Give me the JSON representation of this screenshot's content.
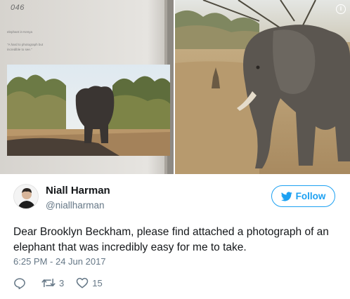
{
  "book": {
    "page_number": "046",
    "caption_title": "elephant in Kenya",
    "caption_line1": "\"A hard to photograph but",
    "caption_line2": "incredible to see.\""
  },
  "tweet": {
    "display_name": "Niall Harman",
    "handle": "@niallharman",
    "follow_label": "Follow",
    "text": "Dear Brooklyn Beckham, please find attached a photograph of an elephant that was incredibly easy for me to take.",
    "timestamp": "6:25 PM - 24 Jun 2017",
    "retweet_count": "3",
    "like_count": "15"
  },
  "colors": {
    "accent": "#1da1f2",
    "muted": "#657786",
    "text": "#14171a"
  },
  "icons": {
    "info": "info-icon",
    "bird": "twitter-bird-icon",
    "reply": "reply-icon",
    "retweet": "retweet-icon",
    "like": "heart-icon"
  }
}
